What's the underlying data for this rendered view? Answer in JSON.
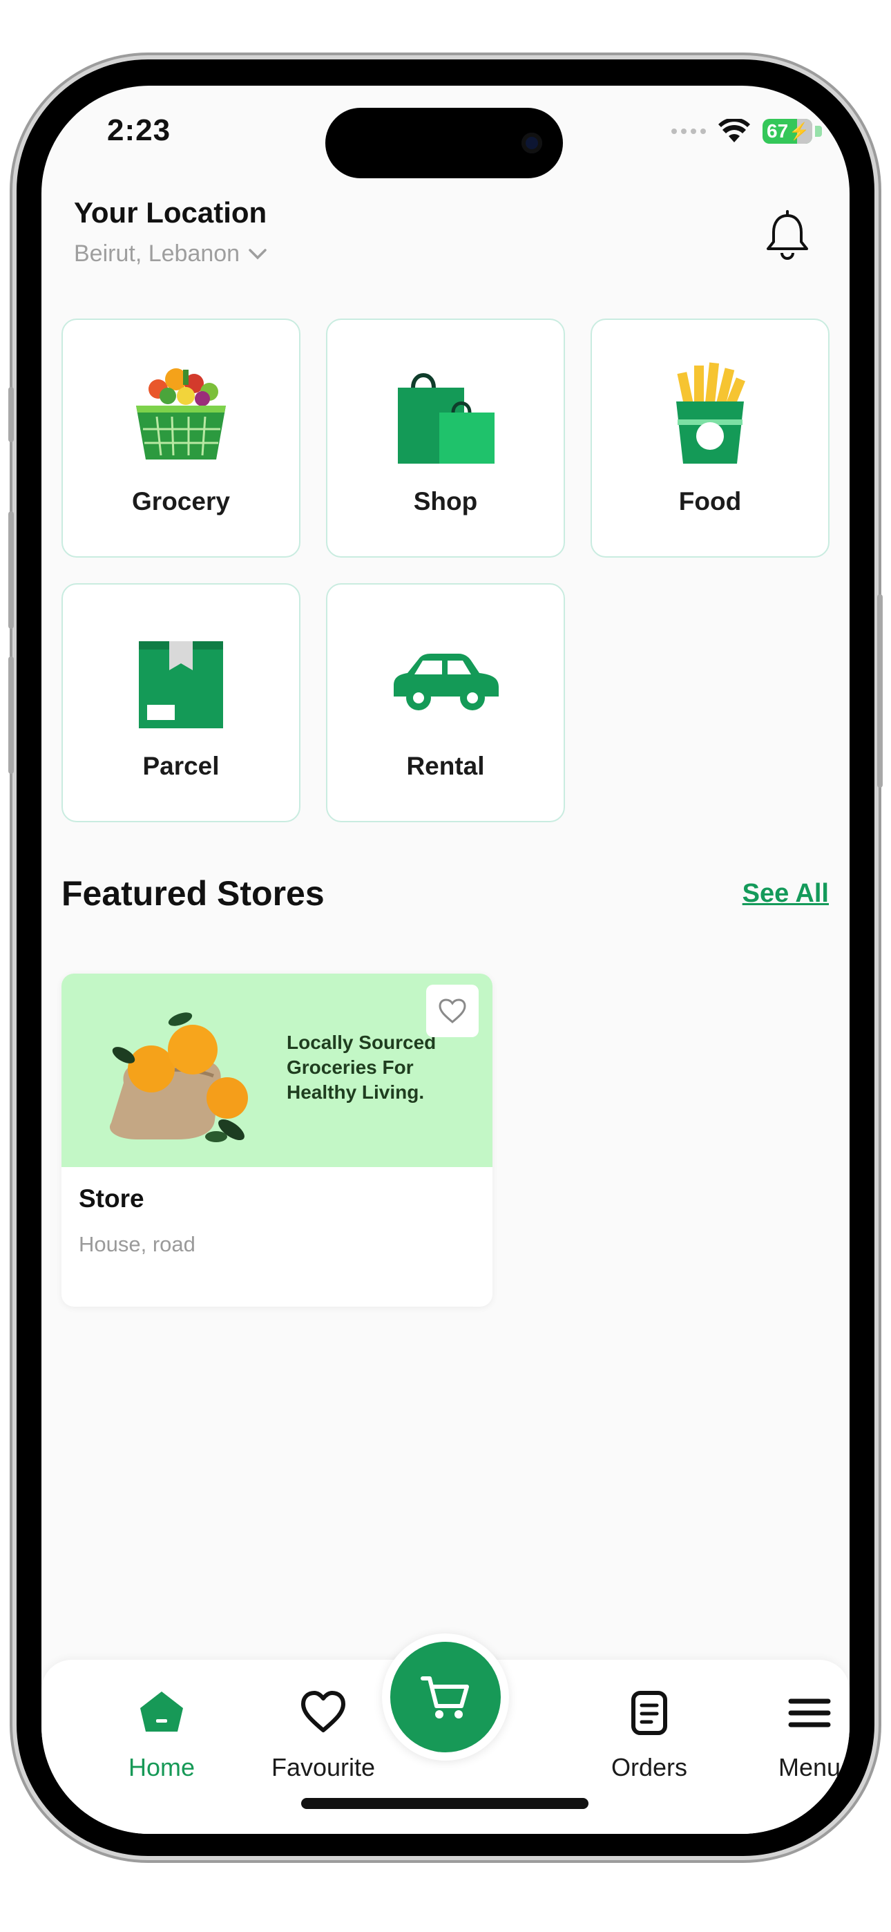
{
  "status_bar": {
    "time": "2:23",
    "battery": "67"
  },
  "header": {
    "location_title": "Your Location",
    "location_value": "Beirut, Lebanon"
  },
  "categories": [
    {
      "label": "Grocery",
      "icon": "grocery-basket-icon"
    },
    {
      "label": "Shop",
      "icon": "shopping-bag-icon"
    },
    {
      "label": "Food",
      "icon": "fries-icon"
    },
    {
      "label": "Parcel",
      "icon": "parcel-box-icon"
    },
    {
      "label": "Rental",
      "icon": "car-icon"
    }
  ],
  "featured": {
    "title": "Featured Stores",
    "see_all": "See All",
    "stores": [
      {
        "banner_text": "Locally Sourced Groceries For Healthy Living.",
        "name": "Store",
        "address": "House, road"
      }
    ]
  },
  "bottom_nav": {
    "items": [
      {
        "label": "Home",
        "icon": "home-icon",
        "active": true
      },
      {
        "label": "Favourite",
        "icon": "heart-icon"
      },
      {
        "label": "Orders",
        "icon": "orders-icon"
      },
      {
        "label": "Menu",
        "icon": "menu-icon"
      }
    ],
    "cart_icon": "cart-icon"
  },
  "colors": {
    "accent": "#179957",
    "banner": "#c3f7c6",
    "card_border": "#c9ece0"
  }
}
